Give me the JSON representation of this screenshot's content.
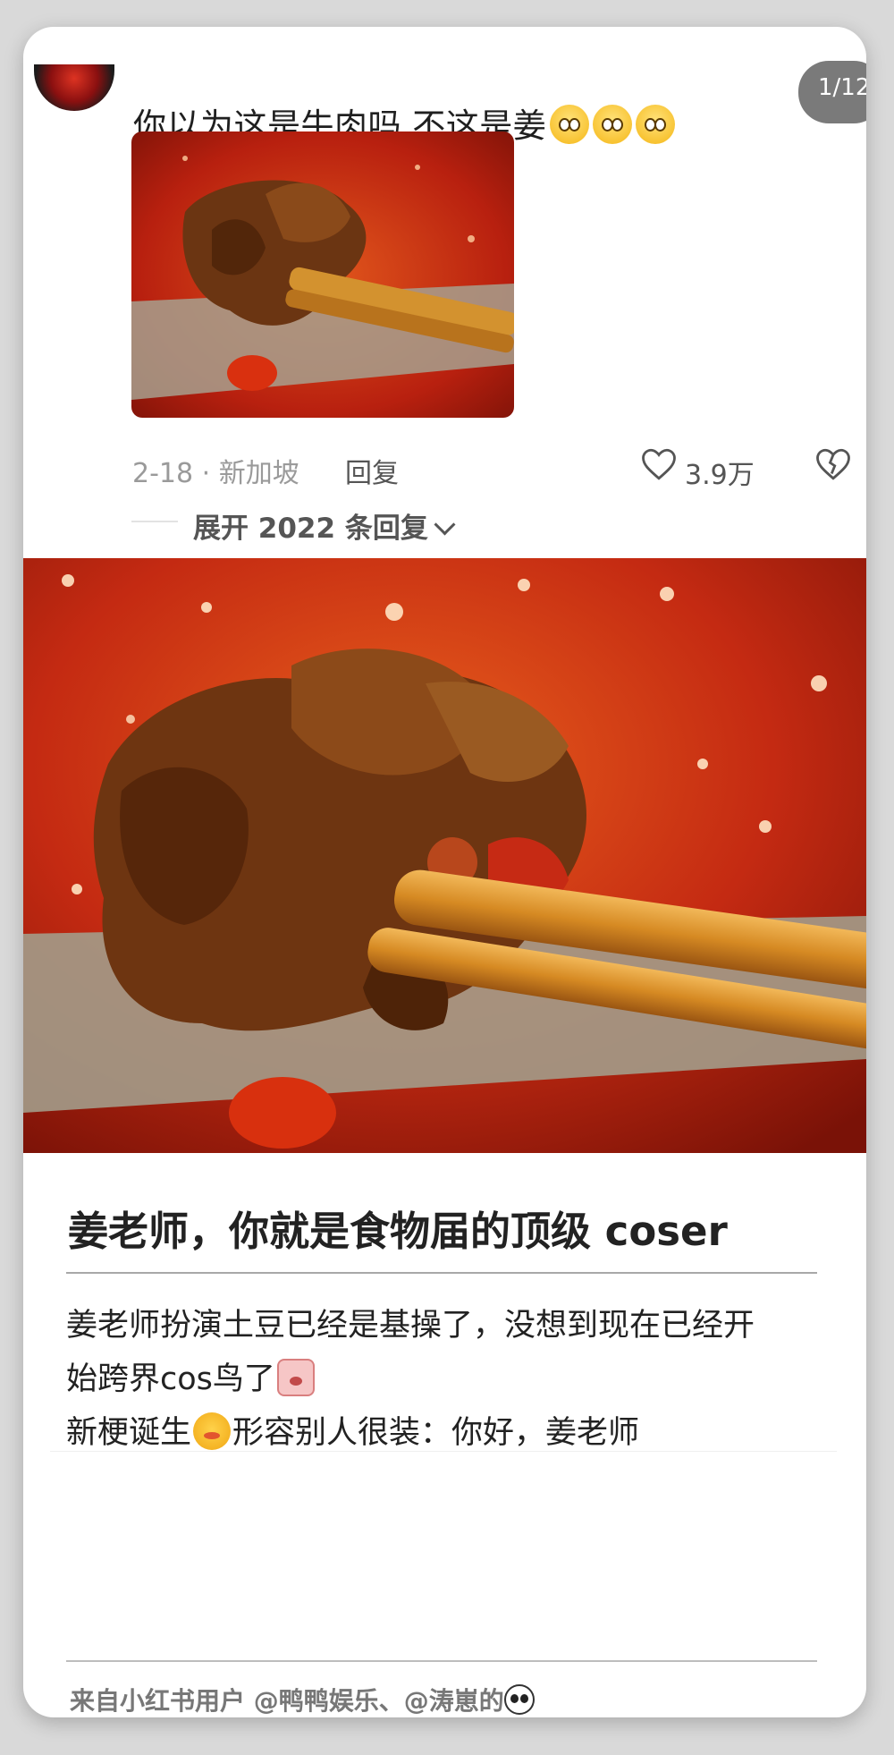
{
  "comment": {
    "text": "你以为这是牛肉吗 不这是姜",
    "date_location": "2-18 · 新加坡",
    "reply_label": "回复",
    "like_count": "3.9万",
    "expand_label": "展开 2022 条回复",
    "page_indicator": "1/12"
  },
  "article": {
    "title": "姜老师，你就是食物届的顶级 coser",
    "line1": "姜老师扮演土豆已经是基操了，没想到现在已经开",
    "line2": "始跨界cos鸟了",
    "line3a": "新梗诞生",
    "line3b": "形容别人很装：你好，姜老师",
    "footer": "来自小红书用户 @鸭鸭娱乐、@涛崽的"
  },
  "colors": {
    "accent_red": "#c62a14",
    "text_primary": "#1f1f1f",
    "text_secondary": "#9a9a9a"
  },
  "icons": [
    "heart-icon",
    "broken-heart-icon",
    "chevron-down-icon",
    "pleading-face-emoji",
    "panda-emoji"
  ]
}
